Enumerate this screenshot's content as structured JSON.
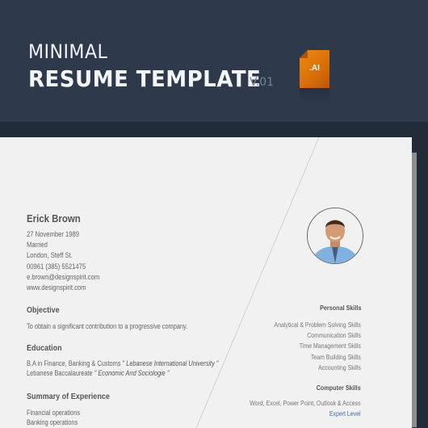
{
  "banner": {
    "title_small": "MINIMAL",
    "title_big": "RESUME TEMPLATE",
    "version": "V.01",
    "file_badge": ".AI",
    "file_icon": "document-icon",
    "colors": {
      "banner_bg": "#2e3a4b",
      "page_bg": "#222c39",
      "accent_orange": "#e07a0c",
      "version_text": "#6f86a0"
    }
  },
  "resume": {
    "name": "Erick Brown",
    "info": [
      "27 November 1989",
      "Married",
      "London, Steff St.",
      "00961 (385) 5521475",
      "e.brown@designspirit.com",
      "www.designspirit.com"
    ],
    "objective": {
      "title": "Objective",
      "text": "To obtain a significant contribution to a progressive company."
    },
    "education": {
      "title": "Education",
      "items": [
        {
          "text": "B.A in Finance, Banking & Customs ",
          "institution": "\" Lebanese International University \""
        },
        {
          "text": "Lebanese Baccalaureate ",
          "institution": "\" Economic And Sociologie \""
        }
      ]
    },
    "experience": {
      "title": "Summary of Experience",
      "items": [
        "Financial operations",
        "Banking operations"
      ]
    },
    "photo": "profile-photo",
    "personal_skills": {
      "title": "Personal Skills",
      "items": [
        "Analytical & Problem Solving Skills",
        "Communication Skills",
        "Time Management Skills",
        "Team Building Skills",
        "Accounting Skills"
      ]
    },
    "computer_skills": {
      "title": "Computer Skills",
      "items": [
        "Word, Excel, Power Point, Outlook & Access"
      ],
      "level": "Expert Level",
      "level_color": "#3a6fb5"
    }
  }
}
